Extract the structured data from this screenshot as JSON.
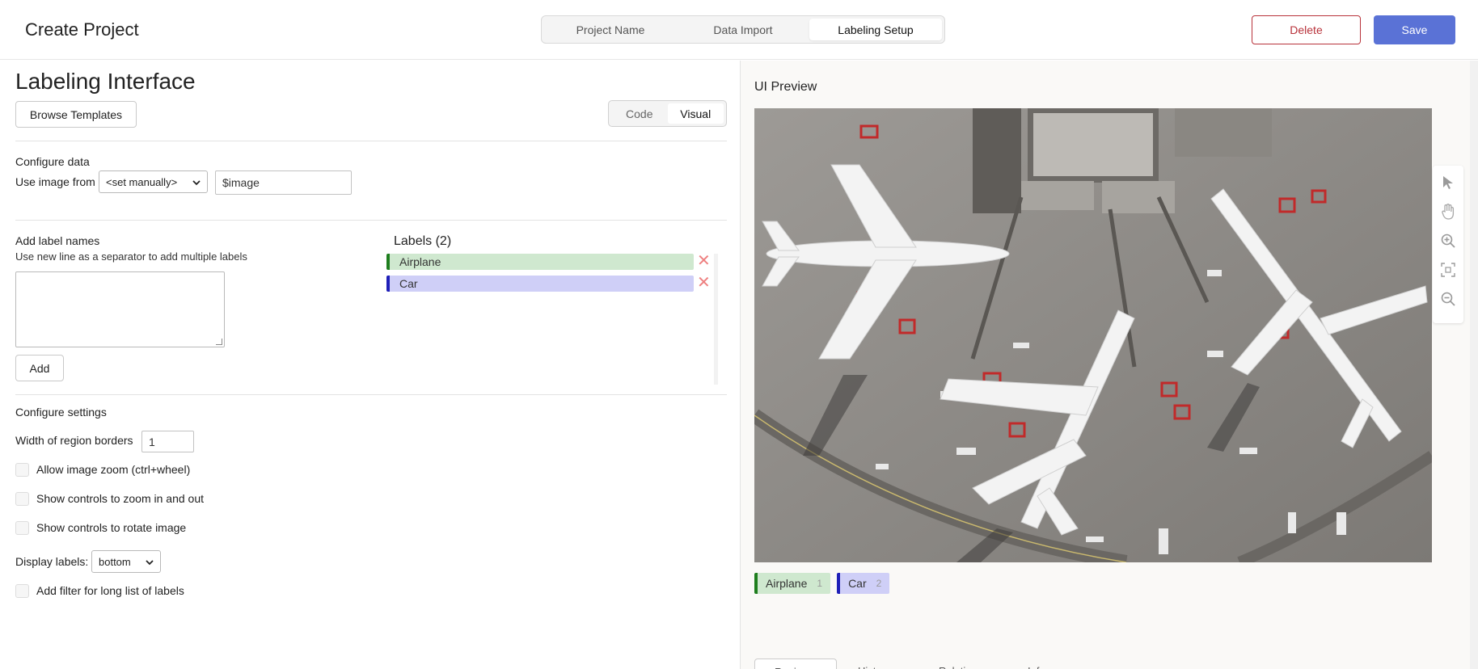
{
  "header": {
    "title": "Create Project",
    "steps": [
      "Project Name",
      "Data Import",
      "Labeling Setup"
    ],
    "active_step": 2,
    "delete_label": "Delete",
    "save_label": "Save"
  },
  "left": {
    "title": "Labeling Interface",
    "browse_templates_label": "Browse Templates",
    "view_toggle": [
      "Code",
      "Visual"
    ],
    "configure_data": {
      "heading": "Configure data",
      "use_image_from_label": "Use image from",
      "source_select_value": "<set manually>",
      "source_input_value": "$image"
    },
    "add_labels": {
      "heading": "Add label names",
      "hint": "Use new line as a separator to add multiple labels",
      "add_button_label": "Add"
    },
    "labels": {
      "title": "Labels (2)",
      "items": [
        {
          "name": "Airplane",
          "color": "#1e7e1e",
          "bg": "#cfe8cf"
        },
        {
          "name": "Car",
          "color": "#1f1fb8",
          "bg": "#cfcff7"
        }
      ],
      "remove_glyph": "✕"
    },
    "configure_settings": {
      "heading": "Configure settings",
      "border_width_label": "Width of region borders",
      "border_width_value": "1",
      "checkbox_zoom": "Allow image zoom (ctrl+wheel)",
      "checkbox_zoom_controls": "Show controls to zoom in and out",
      "checkbox_rotate": "Show controls to rotate image",
      "display_labels_label": "Display labels:",
      "display_labels_value": "bottom",
      "checkbox_filter": "Add filter for long list of labels"
    }
  },
  "right": {
    "preview_title": "UI Preview",
    "preview_labels": [
      {
        "name": "Airplane",
        "hotkey": "1",
        "color": "#1e7e1e",
        "bg": "#cfe8cf"
      },
      {
        "name": "Car",
        "hotkey": "2",
        "color": "#1f1fb8",
        "bg": "#cfcff7"
      }
    ],
    "bottom_tabs": [
      "Regions",
      "History",
      "Relations",
      "Info"
    ],
    "tool_icons": [
      "pointer-icon",
      "hand-icon",
      "zoom-in-icon",
      "fit-icon",
      "zoom-out-icon"
    ]
  }
}
